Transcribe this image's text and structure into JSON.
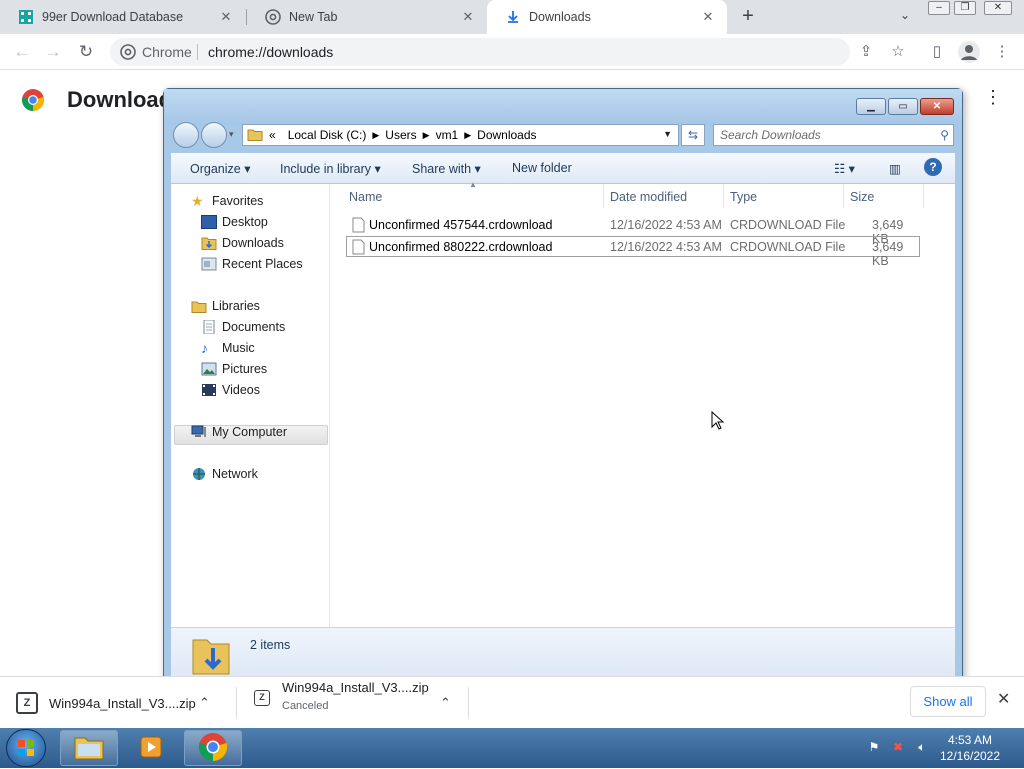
{
  "browser": {
    "tabs": [
      {
        "label": "99er Download Database"
      },
      {
        "label": "New Tab"
      },
      {
        "label": "Downloads"
      }
    ],
    "site_chip": "Chrome",
    "url": "chrome://downloads"
  },
  "downloads_page": {
    "title": "Downloads"
  },
  "explorer": {
    "breadcrumb": [
      "«",
      "Local Disk (C:)",
      "Users",
      "vm1",
      "Downloads"
    ],
    "search_placeholder": "Search Downloads",
    "commands": {
      "organize": "Organize",
      "include": "Include in library",
      "share": "Share with",
      "new_folder": "New folder"
    },
    "nav": {
      "favorites": "Favorites",
      "desktop": "Desktop",
      "downloads": "Downloads",
      "recent": "Recent Places",
      "libraries": "Libraries",
      "documents": "Documents",
      "music": "Music",
      "pictures": "Pictures",
      "videos": "Videos",
      "computer": "My Computer",
      "network": "Network"
    },
    "columns": {
      "name": "Name",
      "date": "Date modified",
      "type": "Type",
      "size": "Size"
    },
    "files": [
      {
        "name": "Unconfirmed 457544.crdownload",
        "date": "12/16/2022 4:53 AM",
        "type": "CRDOWNLOAD File",
        "size": "3,649 KB"
      },
      {
        "name": "Unconfirmed 880222.crdownload",
        "date": "12/16/2022 4:53 AM",
        "type": "CRDOWNLOAD File",
        "size": "3,649 KB"
      }
    ],
    "status": "2 items"
  },
  "shelf": {
    "items": [
      {
        "name": "Win994a_Install_V3....zip",
        "status": ""
      },
      {
        "name": "Win994a_Install_V3....zip",
        "status": "Canceled"
      }
    ],
    "show_all": "Show all"
  },
  "taskbar": {
    "time": "4:53 AM",
    "date": "12/16/2022"
  },
  "colors": {
    "chrome_blue": "#1a73e8",
    "tab_strip": "#dee1e6",
    "explorer_frame": "#a8c8e8",
    "taskbar": "#2c5a8c"
  }
}
